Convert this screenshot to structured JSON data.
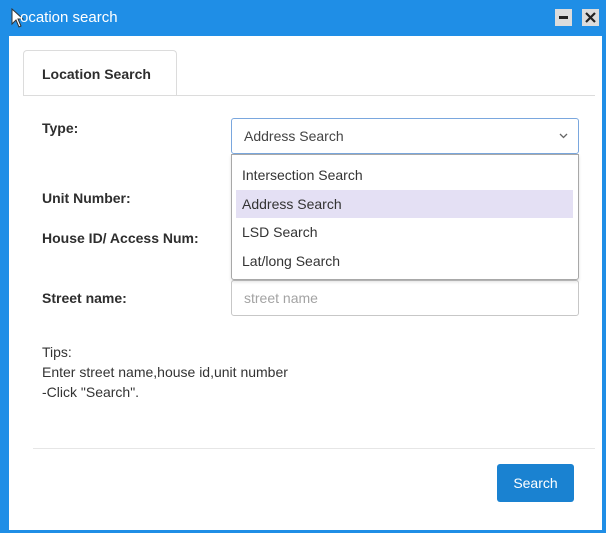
{
  "window": {
    "title": "ocation search",
    "colors": {
      "titlebar": "#1f8ee6",
      "accent_button": "#1a82d1",
      "selected_option": "#e4e0f4"
    },
    "controls": {
      "minimize_icon": "minimize-icon",
      "close_icon": "close-icon"
    }
  },
  "tabs": [
    {
      "label": "Location Search",
      "active": true
    }
  ],
  "form": {
    "type_label": "Type:",
    "type_value": "Address Search",
    "type_options": [
      "Intersection Search",
      "Address Search",
      "LSD Search",
      "Lat/long Search"
    ],
    "type_selected_index": 1,
    "unit_label": "Unit Number:",
    "house_label": "House ID/ Access Num:",
    "street_label": "Street name:",
    "street_placeholder": "street name",
    "street_value": ""
  },
  "tips": {
    "heading": "Tips:",
    "line1": "Enter street name,house id,unit number",
    "line2": "-Click \"Search\"."
  },
  "footer": {
    "search_label": "Search"
  }
}
